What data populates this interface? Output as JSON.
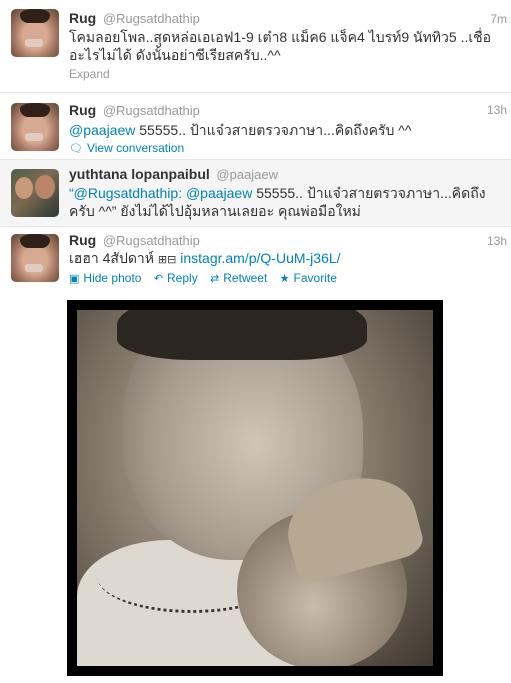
{
  "tweets": [
    {
      "fullname": "Rug",
      "handle": "@Rugsatdhathip",
      "time": "7m",
      "text": "โคมลอยโพล..สุดหล่อเอเอฟ1-9 เต๋า8 แม็ค6 แจ็ค4 ไบรท์9 นัททิว5 ..เชื่ออะไรไม่ได้ ดังนั้นอย่าซีเรียสครับ..^^",
      "action": "Expand"
    },
    {
      "fullname": "Rug",
      "handle": "@Rugsatdhathip",
      "time": "13h",
      "mention": "@paajaew",
      "text": " 55555.. ป้าแจ๋วสายตรวจภาษา...คิดถึงครับ ^^",
      "action": "View conversation"
    },
    {
      "fullname": "yuthtana lopanpaibul",
      "handle": "@paajaew",
      "quote_open": "“",
      "mention1": "@Rugsatdhathip",
      "sep": ": ",
      "mention2": "@paajaew",
      "text": " 55555.. ป้าแจ๋วสายตรวจภาษา...คิดถึงครับ ^^” ยังไม่ได้ไปอุ้มหลานเลยอะ คุณพ่อมือใหม่"
    },
    {
      "fullname": "Rug",
      "handle": "@Rugsatdhathip",
      "time": "13h",
      "text": "เฮฮา 4สัปดาห์ ",
      "glyphs": "⊞⊟",
      "link": "instagr.am/p/Q-UuM-j36L/",
      "actions": {
        "hide_photo": "Hide photo",
        "reply": "Reply",
        "retweet": "Retweet",
        "favorite": "Favorite"
      }
    }
  ],
  "icons": {
    "hide_photo": "photo-icon",
    "reply": "reply-icon",
    "retweet": "retweet-icon",
    "favorite": "star-icon",
    "conversation": "speech-bubble-icon"
  },
  "colors": {
    "link": "#0084b4",
    "meta": "#999999"
  }
}
